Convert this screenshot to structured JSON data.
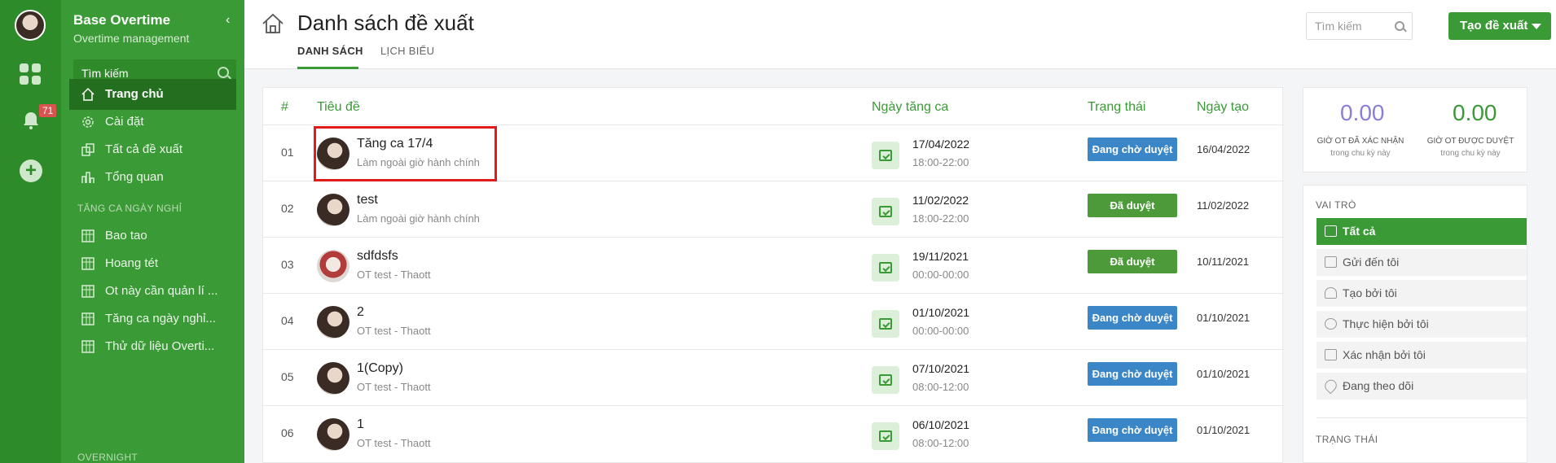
{
  "rail": {
    "notification_count": "71"
  },
  "sidebar": {
    "title": "Base Overtime",
    "subtitle": "Overtime management",
    "search_label": "Tìm kiếm",
    "items": [
      {
        "label": "Trang chủ"
      },
      {
        "label": "Cài đặt"
      },
      {
        "label": "Tất cả đề xuất"
      },
      {
        "label": "Tổng quan"
      }
    ],
    "section1": "TĂNG CA NGÀY NGHỈ",
    "group_items": [
      {
        "label": "Bao tao"
      },
      {
        "label": "Hoang tét"
      },
      {
        "label": "Ot này cần quản lí ..."
      },
      {
        "label": "Tăng ca ngày nghỉ..."
      },
      {
        "label": "Thử dữ liệu Overti..."
      }
    ],
    "section2": "OVERNIGHT"
  },
  "header": {
    "title": "Danh sách đề xuất",
    "tabs": [
      "DANH SÁCH",
      "LỊCH BIỂU"
    ],
    "search_placeholder": "Tìm kiếm",
    "create_label": "Tạo đề xuất"
  },
  "table": {
    "columns": [
      "#",
      "Tiêu đề",
      "Ngày tăng ca",
      "Trạng thái",
      "Ngày tạo"
    ],
    "rows": [
      {
        "num": "01",
        "title": "Tăng ca 17/4",
        "sub": "Làm ngoài giờ hành chính",
        "date": "17/04/2022",
        "time": "18:00-22:00",
        "status": "Đang chờ duyệt",
        "created": "16/04/2022"
      },
      {
        "num": "02",
        "title": "test",
        "sub": "Làm ngoài giờ hành chính",
        "date": "11/02/2022",
        "time": "18:00-22:00",
        "status": "Đã duyệt",
        "created": "11/02/2022"
      },
      {
        "num": "03",
        "title": "sdfdsfs",
        "sub": "OT test - Thaott",
        "date": "19/11/2021",
        "time": "00:00-00:00",
        "status": "Đã duyệt",
        "created": "10/11/2021"
      },
      {
        "num": "04",
        "title": "2",
        "sub": "OT test - Thaott",
        "date": "01/10/2021",
        "time": "00:00-00:00",
        "status": "Đang chờ duyệt",
        "created": "01/10/2021"
      },
      {
        "num": "05",
        "title": "1(Copy)",
        "sub": "OT test - Thaott",
        "date": "07/10/2021",
        "time": "08:00-12:00",
        "status": "Đang chờ duyệt",
        "created": "01/10/2021"
      },
      {
        "num": "06",
        "title": "1",
        "sub": "OT test - Thaott",
        "date": "06/10/2021",
        "time": "08:00-12:00",
        "status": "Đang chờ duyệt",
        "created": "01/10/2021"
      }
    ]
  },
  "stats": {
    "confirmed_value": "0.00",
    "confirmed_label": "GIỜ OT ĐÃ XÁC NHẬN",
    "approved_value": "0.00",
    "approved_label": "GIỜ OT ĐƯỢC DUYỆT",
    "period": "trong chu kỳ này"
  },
  "filters": {
    "role_heading": "VAI TRÒ",
    "roles": [
      "Tất cả",
      "Gửi đến tôi",
      "Tạo bởi tôi",
      "Thực hiện bởi tôi",
      "Xác nhận bởi tôi",
      "Đang theo dõi"
    ],
    "status_heading": "TRẠNG THÁI"
  },
  "colors": {
    "brand": "#3a9a35",
    "pending": "#3b86c6",
    "approved": "#4c9a3a",
    "stat_purple": "#8a7fd6",
    "stat_green": "#3a9a35"
  }
}
